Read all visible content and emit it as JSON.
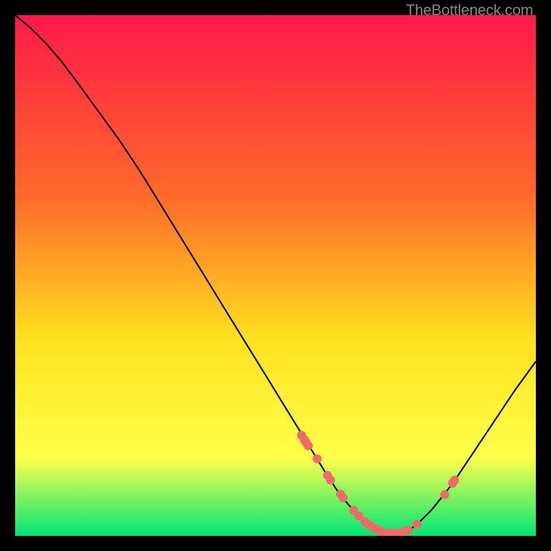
{
  "watermark": "TheBottleneck.com",
  "chart_data": {
    "type": "line",
    "title": "",
    "xlabel": "",
    "ylabel": "",
    "xlim": [
      0,
      100
    ],
    "ylim": [
      0,
      100
    ],
    "grid": false,
    "legend": false,
    "background_gradient": {
      "top": "#ff1a49",
      "upper_mid": "#ff6a2a",
      "mid": "#ffe01f",
      "lower_mid": "#ffff4a",
      "bottom": "#00e676"
    },
    "series": [
      {
        "name": "bottleneck-curve",
        "color": "#000000",
        "x": [
          0,
          3,
          6,
          9,
          12,
          16,
          20,
          24,
          28,
          32,
          36,
          40,
          44,
          48,
          52,
          56,
          60,
          62,
          64,
          66,
          68,
          70,
          72,
          74,
          76,
          78,
          80,
          84,
          88,
          92,
          96,
          100
        ],
        "y": [
          100,
          97.5,
          94.5,
          91,
          87,
          81.5,
          76,
          70,
          63.5,
          57,
          50.5,
          44,
          37.5,
          31,
          24.5,
          18,
          11.5,
          8.5,
          6,
          4,
          2.2,
          1,
          0.5,
          0.5,
          1.3,
          3,
          5,
          10,
          16,
          22,
          28,
          33.5
        ]
      }
    ],
    "markers": {
      "name": "highlighted-points",
      "color": "#f06a6a",
      "points": [
        {
          "x": 55.0,
          "y": 19.3
        },
        {
          "x": 55.6,
          "y": 18.4
        },
        {
          "x": 55.9,
          "y": 17.9
        },
        {
          "x": 56.3,
          "y": 17.3
        },
        {
          "x": 58.0,
          "y": 14.8
        },
        {
          "x": 60.0,
          "y": 11.6
        },
        {
          "x": 60.6,
          "y": 10.7
        },
        {
          "x": 62.5,
          "y": 8.0
        },
        {
          "x": 63.0,
          "y": 7.3
        },
        {
          "x": 65.0,
          "y": 4.9
        },
        {
          "x": 66.0,
          "y": 3.8
        },
        {
          "x": 67.2,
          "y": 2.7
        },
        {
          "x": 68.0,
          "y": 2.1
        },
        {
          "x": 68.8,
          "y": 1.6
        },
        {
          "x": 69.5,
          "y": 1.2
        },
        {
          "x": 70.2,
          "y": 0.9
        },
        {
          "x": 71.0,
          "y": 0.6
        },
        {
          "x": 71.8,
          "y": 0.5
        },
        {
          "x": 72.5,
          "y": 0.5
        },
        {
          "x": 73.3,
          "y": 0.5
        },
        {
          "x": 74.0,
          "y": 0.6
        },
        {
          "x": 74.7,
          "y": 0.8
        },
        {
          "x": 75.5,
          "y": 1.1
        },
        {
          "x": 77.2,
          "y": 2.2
        },
        {
          "x": 82.5,
          "y": 7.9
        },
        {
          "x": 84.0,
          "y": 10.1
        },
        {
          "x": 84.4,
          "y": 10.7
        }
      ]
    }
  }
}
